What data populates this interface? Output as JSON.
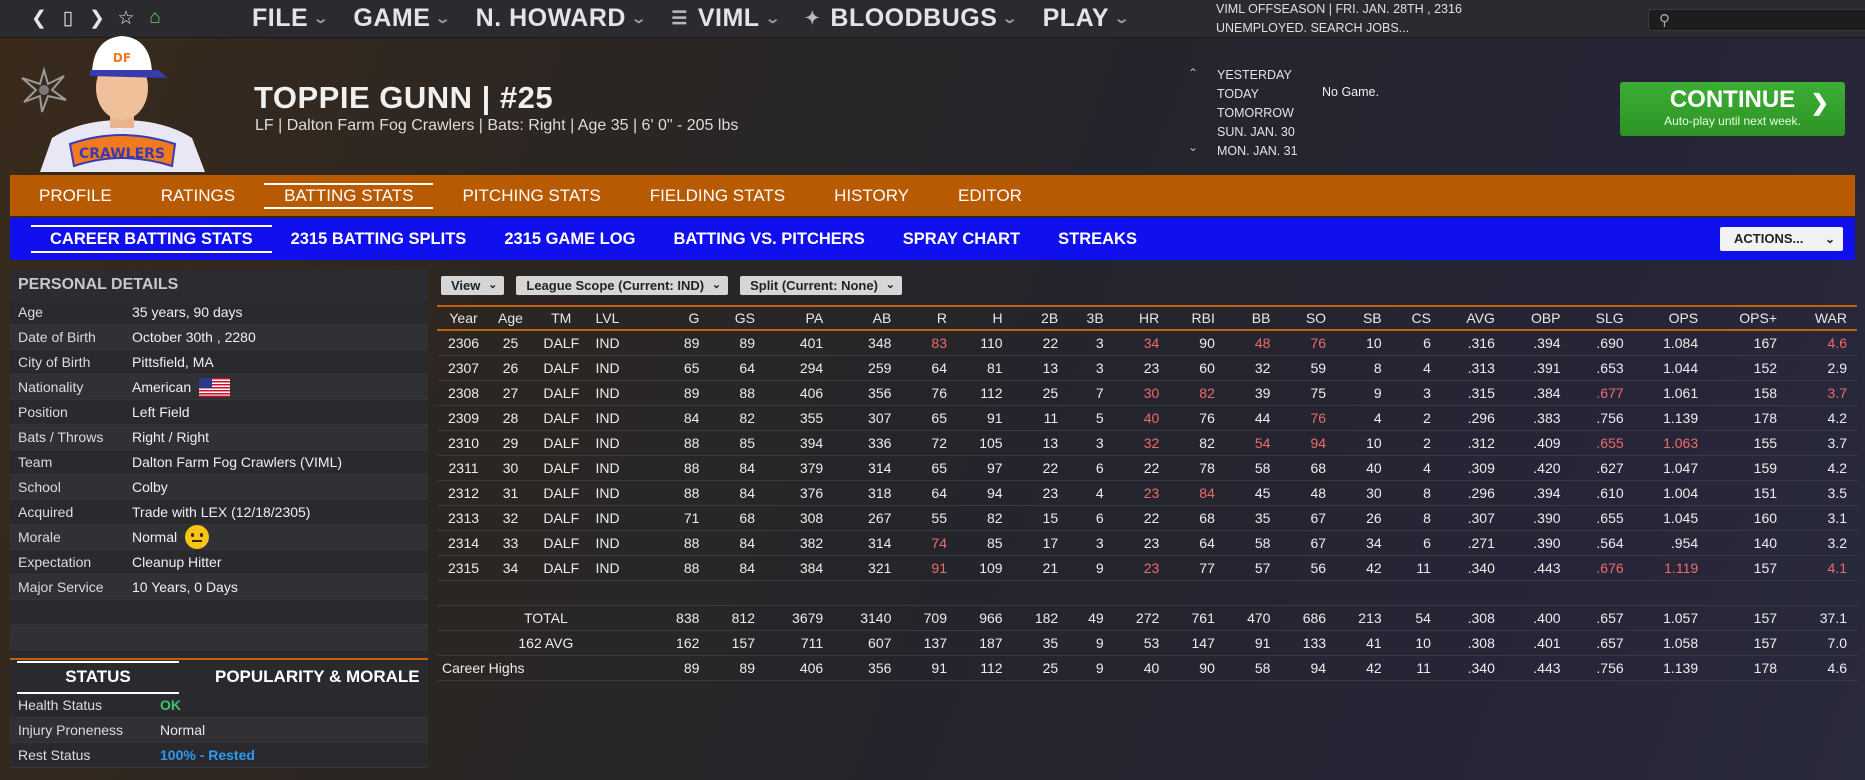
{
  "topbar": {
    "nav_icons": [
      "back-icon",
      "copy-icon",
      "forward-icon",
      "star-icon",
      "home-icon"
    ],
    "menus": [
      {
        "label": "FILE",
        "icon": ""
      },
      {
        "label": "GAME",
        "icon": ""
      },
      {
        "label": "N. HOWARD",
        "icon": ""
      },
      {
        "label": "VIML",
        "icon": "viml-logo"
      },
      {
        "label": "BLOODBUGS",
        "icon": "bloodbugs-logo"
      },
      {
        "label": "PLAY",
        "icon": ""
      }
    ],
    "league_status": "VIML OFFSEASON  |  FRI. JAN. 28TH , 2316",
    "job_status": "UNEMPLOYED. SEARCH JOBS...",
    "search_placeholder": ""
  },
  "player": {
    "name": "TOPPIE GUNN  |  #25",
    "info": "LF | Dalton Farm Fog Crawlers  |  Bats: Right  |  Age 35  |  6' 0\"  - 205 lbs"
  },
  "schedule": {
    "days": [
      "YESTERDAY",
      "TODAY",
      "TOMORROW",
      "SUN. JAN. 30",
      "MON. JAN. 31"
    ],
    "today_note": "No Game."
  },
  "continue": {
    "title": "CONTINUE",
    "subtitle": "Auto-play until next week.",
    "color": "#36a32e"
  },
  "main_tabs": [
    "PROFILE",
    "RATINGS",
    "BATTING STATS",
    "PITCHING STATS",
    "FIELDING STATS",
    "HISTORY",
    "EDITOR"
  ],
  "sub_tabs": [
    "CAREER BATTING STATS",
    "2315 BATTING SPLITS",
    "2315 GAME LOG",
    "BATTING VS. PITCHERS",
    "SPRAY CHART",
    "STREAKS"
  ],
  "actions_label": "ACTIONS...",
  "personal": {
    "title": "PERSONAL DETAILS",
    "rows": [
      {
        "label": "Age",
        "value": "35 years, 90 days"
      },
      {
        "label": "Date of Birth",
        "value": "October 30th , 2280"
      },
      {
        "label": "City of Birth",
        "value": "Pittsfield, MA"
      },
      {
        "label": "Nationality",
        "value": "American"
      },
      {
        "label": "Position",
        "value": "Left Field"
      },
      {
        "label": "Bats / Throws",
        "value": "Right / Right"
      },
      {
        "label": "Team",
        "value": "Dalton Farm Fog Crawlers (VIML)"
      },
      {
        "label": "School",
        "value": "Colby"
      },
      {
        "label": "Acquired",
        "value": "Trade with LEX (12/18/2305)"
      },
      {
        "label": "Morale",
        "value": "Normal"
      },
      {
        "label": "Expectation",
        "value": "Cleanup Hitter"
      },
      {
        "label": "Major Service",
        "value": "10 Years, 0 Days"
      }
    ]
  },
  "status": {
    "tabs": [
      "STATUS",
      "POPULARITY & MORALE"
    ],
    "rows": [
      {
        "label": "Health Status",
        "value": "OK"
      },
      {
        "label": "Injury Proneness",
        "value": "Normal"
      },
      {
        "label": "Rest Status",
        "value": "100% - Rested"
      }
    ]
  },
  "filters": [
    "View",
    "League Scope (Current: IND)",
    "Split  (Current: None)"
  ],
  "stats": {
    "columns": [
      "Year",
      "Age",
      "TM",
      "LVL",
      "G",
      "GS",
      "PA",
      "AB",
      "R",
      "H",
      "2B",
      "3B",
      "HR",
      "RBI",
      "BB",
      "SO",
      "SB",
      "CS",
      "AVG",
      "OBP",
      "SLG",
      "OPS",
      "OPS+",
      "WAR"
    ],
    "rows": [
      [
        "2306",
        "25",
        "DALF",
        "IND",
        "89",
        "89",
        "401",
        "348",
        "83",
        "110",
        "22",
        "3",
        "34",
        "90",
        "48",
        "76",
        "10",
        "6",
        ".316",
        ".394",
        ".690",
        "1.084",
        "167",
        "4.6"
      ],
      [
        "2307",
        "26",
        "DALF",
        "IND",
        "65",
        "64",
        "294",
        "259",
        "64",
        "81",
        "13",
        "3",
        "23",
        "60",
        "32",
        "59",
        "8",
        "4",
        ".313",
        ".391",
        ".653",
        "1.044",
        "152",
        "2.9"
      ],
      [
        "2308",
        "27",
        "DALF",
        "IND",
        "89",
        "88",
        "406",
        "356",
        "76",
        "112",
        "25",
        "7",
        "30",
        "82",
        "39",
        "75",
        "9",
        "3",
        ".315",
        ".384",
        ".677",
        "1.061",
        "158",
        "3.7"
      ],
      [
        "2309",
        "28",
        "DALF",
        "IND",
        "84",
        "82",
        "355",
        "307",
        "65",
        "91",
        "11",
        "5",
        "40",
        "76",
        "44",
        "76",
        "4",
        "2",
        ".296",
        ".383",
        ".756",
        "1.139",
        "178",
        "4.2"
      ],
      [
        "2310",
        "29",
        "DALF",
        "IND",
        "88",
        "85",
        "394",
        "336",
        "72",
        "105",
        "13",
        "3",
        "32",
        "82",
        "54",
        "94",
        "10",
        "2",
        ".312",
        ".409",
        ".655",
        "1.063",
        "155",
        "3.7"
      ],
      [
        "2311",
        "30",
        "DALF",
        "IND",
        "88",
        "84",
        "379",
        "314",
        "65",
        "97",
        "22",
        "6",
        "22",
        "78",
        "58",
        "68",
        "40",
        "4",
        ".309",
        ".420",
        ".627",
        "1.047",
        "159",
        "4.2"
      ],
      [
        "2312",
        "31",
        "DALF",
        "IND",
        "88",
        "84",
        "376",
        "318",
        "64",
        "94",
        "23",
        "4",
        "23",
        "84",
        "45",
        "48",
        "30",
        "8",
        ".296",
        ".394",
        ".610",
        "1.004",
        "151",
        "3.5"
      ],
      [
        "2313",
        "32",
        "DALF",
        "IND",
        "71",
        "68",
        "308",
        "267",
        "55",
        "82",
        "15",
        "6",
        "22",
        "68",
        "35",
        "67",
        "26",
        "8",
        ".307",
        ".390",
        ".655",
        "1.045",
        "160",
        "3.1"
      ],
      [
        "2314",
        "33",
        "DALF",
        "IND",
        "88",
        "84",
        "382",
        "314",
        "74",
        "85",
        "17",
        "3",
        "23",
        "64",
        "58",
        "67",
        "34",
        "6",
        ".271",
        ".390",
        ".564",
        ".954",
        "140",
        "3.2"
      ],
      [
        "2315",
        "34",
        "DALF",
        "IND",
        "88",
        "84",
        "384",
        "321",
        "91",
        "109",
        "21",
        "9",
        "23",
        "77",
        "57",
        "56",
        "42",
        "11",
        ".340",
        ".443",
        ".676",
        "1.119",
        "157",
        "4.1"
      ]
    ],
    "highlights": [
      [
        0,
        8
      ],
      [
        0,
        12
      ],
      [
        0,
        14
      ],
      [
        0,
        15
      ],
      [
        0,
        23
      ],
      [
        2,
        12
      ],
      [
        2,
        13
      ],
      [
        2,
        20
      ],
      [
        2,
        23
      ],
      [
        3,
        12
      ],
      [
        3,
        15
      ],
      [
        4,
        12
      ],
      [
        4,
        14
      ],
      [
        4,
        15
      ],
      [
        4,
        20
      ],
      [
        4,
        21
      ],
      [
        6,
        12
      ],
      [
        6,
        13
      ],
      [
        8,
        8
      ],
      [
        9,
        8
      ],
      [
        9,
        12
      ],
      [
        9,
        20
      ],
      [
        9,
        21
      ],
      [
        9,
        23
      ]
    ],
    "highlight_color": "#f06a6a",
    "totals": [
      [
        "TOTAL",
        "838",
        "812",
        "3679",
        "3140",
        "709",
        "966",
        "182",
        "49",
        "272",
        "761",
        "470",
        "686",
        "213",
        "54",
        ".308",
        ".400",
        ".657",
        "1.057",
        "157",
        "37.1"
      ],
      [
        "162 AVG",
        "162",
        "157",
        "711",
        "607",
        "137",
        "187",
        "35",
        "9",
        "53",
        "147",
        "91",
        "133",
        "41",
        "10",
        ".308",
        ".401",
        ".657",
        "1.058",
        "157",
        "7.0"
      ],
      [
        "Career Highs",
        "89",
        "89",
        "406",
        "356",
        "91",
        "112",
        "25",
        "9",
        "40",
        "90",
        "58",
        "94",
        "42",
        "11",
        ".340",
        ".443",
        ".756",
        "1.139",
        "178",
        "4.6"
      ]
    ]
  }
}
